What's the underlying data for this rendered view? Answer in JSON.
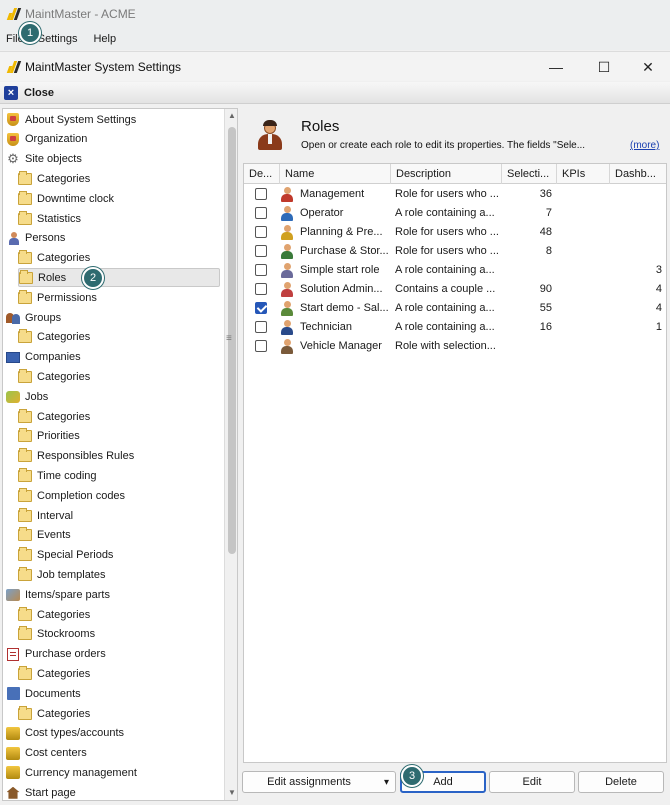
{
  "app": {
    "title": "MaintMaster - ACME"
  },
  "menu": {
    "items": [
      "File",
      "Settings",
      "Help"
    ]
  },
  "dialog": {
    "title": "MaintMaster System Settings",
    "close_label": "Close",
    "minimize": "—",
    "maximize": "☐",
    "close_glyph": "✕"
  },
  "badges": [
    "1",
    "2",
    "3"
  ],
  "tree": {
    "items": [
      {
        "label": "About System Settings",
        "icon": "shield-icon"
      },
      {
        "label": "Organization",
        "icon": "shield-icon"
      },
      {
        "label": "Site objects",
        "icon": "gear-icon"
      },
      {
        "label": "Categories",
        "icon": "folder-icon"
      },
      {
        "label": "Downtime clock",
        "icon": "folder-icon"
      },
      {
        "label": "Statistics",
        "icon": "folder-icon"
      },
      {
        "label": "Persons",
        "icon": "person-icon"
      },
      {
        "label": "Categories",
        "icon": "folder-icon"
      },
      {
        "label": "Roles",
        "icon": "folder-icon"
      },
      {
        "label": "Permissions",
        "icon": "folder-icon"
      },
      {
        "label": "Groups",
        "icon": "group-icon"
      },
      {
        "label": "Categories",
        "icon": "folder-icon"
      },
      {
        "label": "Companies",
        "icon": "company-icon"
      },
      {
        "label": "Categories",
        "icon": "folder-icon"
      },
      {
        "label": "Jobs",
        "icon": "jobs-icon"
      },
      {
        "label": "Categories",
        "icon": "folder-icon"
      },
      {
        "label": "Priorities",
        "icon": "folder-icon"
      },
      {
        "label": "Responsibles Rules",
        "icon": "folder-icon"
      },
      {
        "label": "Time coding",
        "icon": "folder-icon"
      },
      {
        "label": "Completion codes",
        "icon": "folder-icon"
      },
      {
        "label": "Interval",
        "icon": "folder-icon"
      },
      {
        "label": "Events",
        "icon": "folder-icon"
      },
      {
        "label": "Special Periods",
        "icon": "folder-icon"
      },
      {
        "label": "Job templates",
        "icon": "folder-icon"
      },
      {
        "label": "Items/spare parts",
        "icon": "items-icon"
      },
      {
        "label": "Categories",
        "icon": "folder-icon"
      },
      {
        "label": "Stockrooms",
        "icon": "folder-icon"
      },
      {
        "label": "Purchase orders",
        "icon": "purchase-order-icon"
      },
      {
        "label": "Categories",
        "icon": "folder-icon"
      },
      {
        "label": "Documents",
        "icon": "documents-icon"
      },
      {
        "label": "Categories",
        "icon": "folder-icon"
      },
      {
        "label": "Cost types/accounts",
        "icon": "coins-icon"
      },
      {
        "label": "Cost centers",
        "icon": "coins-icon"
      },
      {
        "label": "Currency management",
        "icon": "coins-icon"
      },
      {
        "label": "Start page",
        "icon": "start-page-icon"
      }
    ]
  },
  "roles_panel": {
    "title": "Roles",
    "description": "Open or create each role to edit its properties. The fields \"Sele...",
    "more_link": "(more)"
  },
  "grid": {
    "columns": [
      "De...",
      "Name",
      "Description",
      "Selecti...",
      "KPIs",
      "Dashb..."
    ],
    "rows": [
      {
        "checked": false,
        "name": "Management",
        "description": "Role for users who ...",
        "selections": "36",
        "kpis": "",
        "dashboards": ""
      },
      {
        "checked": false,
        "name": "Operator",
        "description": "A role containing a...",
        "selections": "7",
        "kpis": "",
        "dashboards": ""
      },
      {
        "checked": false,
        "name": "Planning & Pre...",
        "description": "Role for users who ...",
        "selections": "48",
        "kpis": "",
        "dashboards": ""
      },
      {
        "checked": false,
        "name": "Purchase & Stor...",
        "description": "Role for users who ...",
        "selections": "8",
        "kpis": "",
        "dashboards": ""
      },
      {
        "checked": false,
        "name": "Simple start role",
        "description": "A role containing a...",
        "selections": "",
        "kpis": "",
        "dashboards": "3"
      },
      {
        "checked": false,
        "name": "Solution Admin...",
        "description": "Contains a couple ...",
        "selections": "90",
        "kpis": "",
        "dashboards": "4"
      },
      {
        "checked": true,
        "name": "Start demo - Sal...",
        "description": "A role containing a...",
        "selections": "55",
        "kpis": "",
        "dashboards": "4"
      },
      {
        "checked": false,
        "name": "Technician",
        "description": "A role containing a...",
        "selections": "16",
        "kpis": "",
        "dashboards": "1"
      },
      {
        "checked": false,
        "name": "Vehicle Manager",
        "description": "Role with selection...",
        "selections": "",
        "kpis": "",
        "dashboards": ""
      }
    ]
  },
  "buttons": {
    "edit_assignments": "Edit assignments",
    "dropdown_arrow": "▾",
    "add": "Add",
    "edit": "Edit",
    "delete": "Delete"
  },
  "colors": {
    "accent": "#2a63c6",
    "badge": "#2e6b70"
  }
}
